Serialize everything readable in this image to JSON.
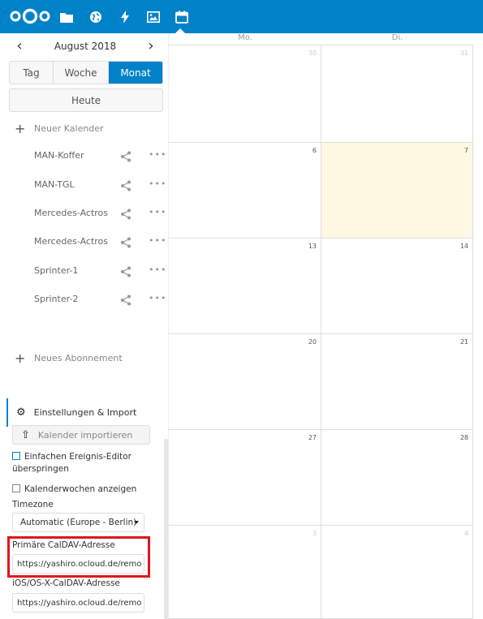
{
  "topbar": {
    "apps": [
      {
        "name": "files-icon"
      },
      {
        "name": "globe-icon"
      },
      {
        "name": "activity-icon"
      },
      {
        "name": "gallery-icon"
      },
      {
        "name": "calendar-icon"
      }
    ],
    "accent": "#0082c9"
  },
  "sidebar": {
    "date_label": "August 2018",
    "prev_symbol": "‹",
    "next_symbol": "›",
    "views": {
      "day": "Tag",
      "week": "Woche",
      "month": "Monat"
    },
    "today_label": "Heute",
    "new_calendar": "Neuer Kalender",
    "calendars": [
      {
        "name": "MAN-Koffer"
      },
      {
        "name": "MAN-TGL"
      },
      {
        "name": "Mercedes-Actros"
      },
      {
        "name": "Mercedes-Actros"
      },
      {
        "name": "Sprinter-1"
      },
      {
        "name": "Sprinter-2"
      }
    ],
    "new_subscription": "Neues Abonnement",
    "settings": {
      "header": "Einstellungen & Import",
      "import_label": "Kalender importieren",
      "simple_editor_line1": "Einfachen Ereignis-Editor",
      "simple_editor_line2": "überspringen",
      "show_weeks": "Kalenderwochen anzeigen",
      "timezone_label": "Timezone",
      "timezone_value": "Automatic (Europe - Berlin)",
      "primary_caldav_label": "Primäre CalDAV-Adresse",
      "primary_caldav_value": "https://yashiro.ocloud.de/remo",
      "ios_caldav_label": "iOS/OS-X-CalDAV-Adresse",
      "ios_caldav_value": "https://yashiro.ocloud.de/remo"
    }
  },
  "calendar": {
    "day_headers": [
      "Mo.",
      "Di."
    ],
    "weeks": [
      [
        "30",
        "31"
      ],
      [
        "6",
        "7"
      ],
      [
        "13",
        "14"
      ],
      [
        "20",
        "21"
      ],
      [
        "27",
        "28"
      ],
      [
        "3",
        "4"
      ]
    ]
  }
}
